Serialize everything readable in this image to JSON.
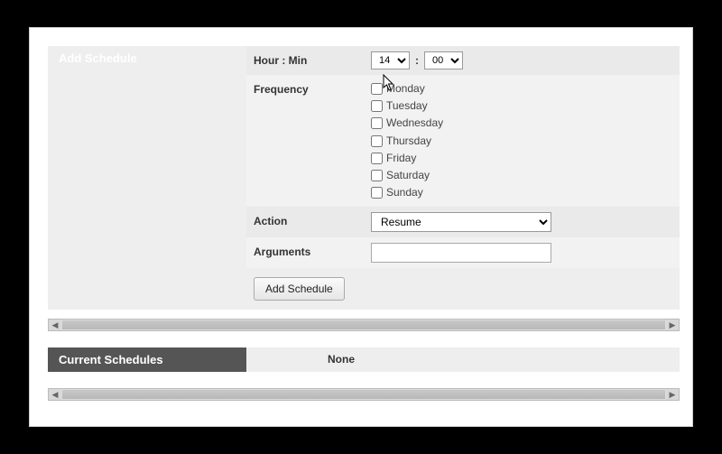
{
  "sections": {
    "add_schedule_title": "Add Schedule",
    "current_schedules_title": "Current Schedules"
  },
  "labels": {
    "hour_min": "Hour : Min",
    "frequency": "Frequency",
    "action": "Action",
    "arguments": "Arguments",
    "colon": ":"
  },
  "values": {
    "hour": "14",
    "minute": "00",
    "action_selected": "Resume",
    "arguments": ""
  },
  "days": {
    "mon": "Monday",
    "tue": "Tuesday",
    "wed": "Wednesday",
    "thu": "Thursday",
    "fri": "Friday",
    "sat": "Saturday",
    "sun": "Sunday"
  },
  "buttons": {
    "add_schedule": "Add Schedule"
  },
  "current": {
    "none": "None"
  }
}
